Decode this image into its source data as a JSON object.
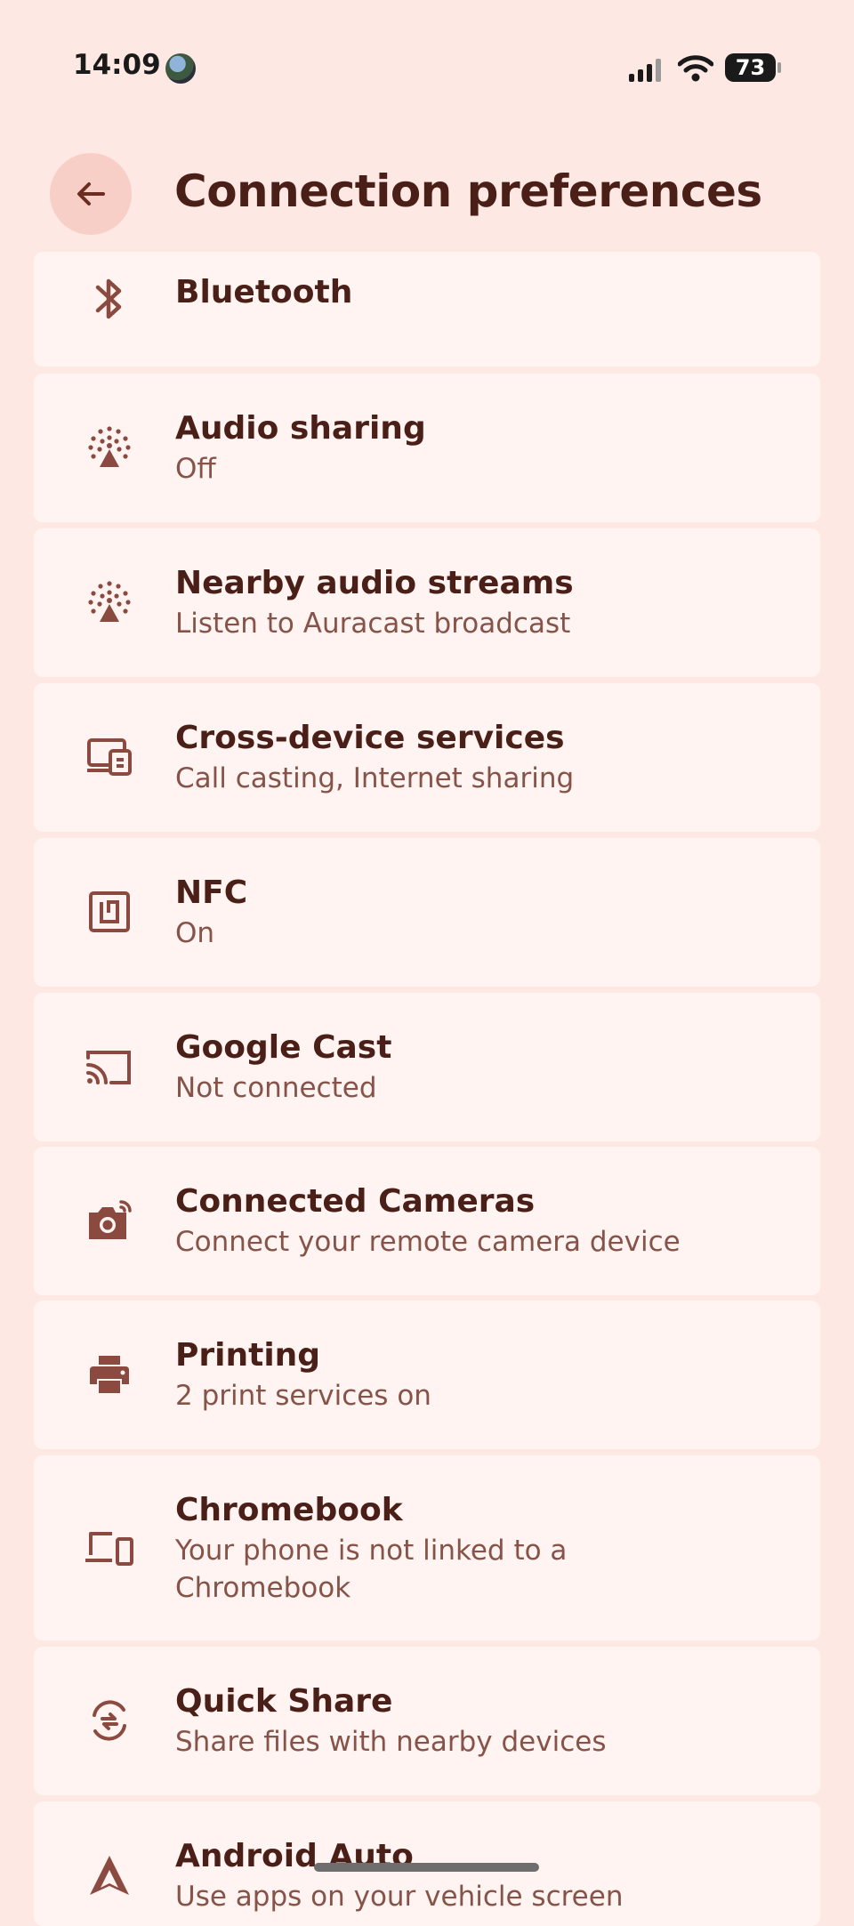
{
  "status_bar": {
    "time": "14:09",
    "battery": "73"
  },
  "header": {
    "title": "Connection preferences"
  },
  "items": [
    {
      "title": "Bluetooth",
      "subtitle": "",
      "icon": "bluetooth-icon"
    },
    {
      "title": "Audio sharing",
      "subtitle": "Off",
      "icon": "audio-sharing-icon"
    },
    {
      "title": "Nearby audio streams",
      "subtitle": "Listen to Auracast broadcast",
      "icon": "audio-stream-icon"
    },
    {
      "title": "Cross-device services",
      "subtitle": "Call casting, Internet sharing",
      "icon": "cross-device-icon"
    },
    {
      "title": "NFC",
      "subtitle": "On",
      "icon": "nfc-icon"
    },
    {
      "title": "Google Cast",
      "subtitle": "Not connected",
      "icon": "cast-icon"
    },
    {
      "title": "Connected Cameras",
      "subtitle": "Connect your remote camera device",
      "icon": "camera-icon"
    },
    {
      "title": "Printing",
      "subtitle": "2 print services on",
      "icon": "printer-icon"
    },
    {
      "title": "Chromebook",
      "subtitle": "Your phone is not linked to a Chromebook",
      "icon": "chromebook-icon"
    },
    {
      "title": "Quick Share",
      "subtitle": "Share files with nearby devices",
      "icon": "quick-share-icon"
    },
    {
      "title": "Android Auto",
      "subtitle": "Use apps on your vehicle screen",
      "icon": "android-auto-icon"
    }
  ],
  "colors": {
    "background": "#fde8e3",
    "card": "#fff4f1",
    "title": "#4a1f17",
    "subtitle": "#865349",
    "icon": "#8b4a3f"
  }
}
